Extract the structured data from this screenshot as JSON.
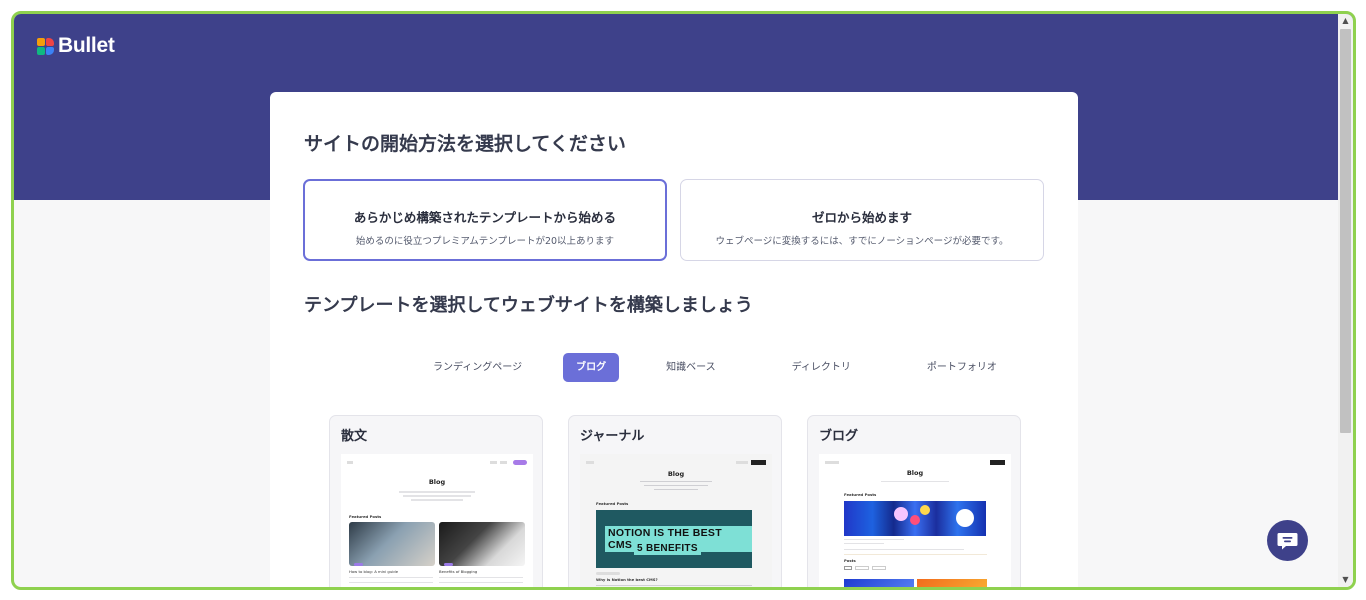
{
  "brand": {
    "name": "Bullet"
  },
  "heading": "サイトの開始方法を選択してください",
  "options": [
    {
      "title": "あらかじめ構築されたテンプレートから始める",
      "subtitle": "始めるのに役立つプレミアムテンプレートが20以上あります",
      "selected": true
    },
    {
      "title": "ゼロから始めます",
      "subtitle": "ウェブページに変換するには、すでにノーションページが必要です。",
      "selected": false
    }
  ],
  "templates_heading": "テンプレートを選択してウェブサイトを構築しましょう",
  "tabs": [
    {
      "label": "ランディングページ",
      "active": false
    },
    {
      "label": "ブログ",
      "active": true
    },
    {
      "label": "知識ベース",
      "active": false
    },
    {
      "label": "ディレクトリ",
      "active": false
    },
    {
      "label": "ポートフォリオ",
      "active": false
    }
  ],
  "template_cards": [
    {
      "name": "散文",
      "preview": {
        "title": "Blog",
        "section_label": "Featured Posts",
        "posts": [
          "How to blog: A mini guide",
          "Benefits of Blogging"
        ]
      }
    },
    {
      "name": "ジャーナル",
      "preview": {
        "title": "Blog",
        "section_label": "Featured Posts",
        "banner_line1": "NOTION IS THE BEST CMS",
        "banner_line2": "5 BENEFITS",
        "post": "Why is Notion the best CMS?"
      }
    },
    {
      "name": "ブログ",
      "preview": {
        "title": "Blog",
        "section_label": "Featured Posts",
        "posts_label": "Posts"
      }
    }
  ],
  "colors": {
    "hero": "#3e418a",
    "accent": "#6b6fd8",
    "frame": "#8fd14f"
  },
  "icons": {
    "chat": "chat-bubble-icon",
    "scroll_up": "scroll-up-arrow-icon",
    "scroll_down": "scroll-down-arrow-icon"
  }
}
